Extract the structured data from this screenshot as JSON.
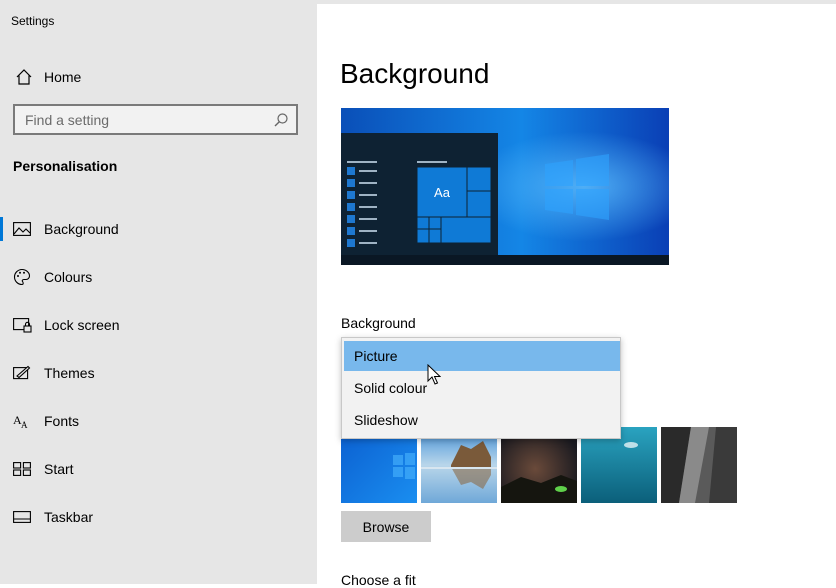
{
  "window": {
    "title": "Settings"
  },
  "sidebar": {
    "home_label": "Home",
    "search_placeholder": "Find a setting",
    "section_title": "Personalisation",
    "items": [
      {
        "label": "Background",
        "icon": "picture-icon",
        "active": true
      },
      {
        "label": "Colours",
        "icon": "palette-icon",
        "active": false
      },
      {
        "label": "Lock screen",
        "icon": "lock-screen-icon",
        "active": false
      },
      {
        "label": "Themes",
        "icon": "themes-icon",
        "active": false
      },
      {
        "label": "Fonts",
        "icon": "fonts-icon",
        "active": false
      },
      {
        "label": "Start",
        "icon": "start-icon",
        "active": false
      },
      {
        "label": "Taskbar",
        "icon": "taskbar-icon",
        "active": false
      }
    ]
  },
  "main": {
    "title": "Background",
    "preview_tile_text": "Aa",
    "background_label": "Background",
    "dropdown": {
      "options": [
        "Picture",
        "Solid colour",
        "Slideshow"
      ],
      "selected": "Picture"
    },
    "browse_label": "Browse",
    "fit_label": "Choose a fit"
  },
  "colors": {
    "accent": "#0078d7",
    "sidebar_bg": "#e6e6e6",
    "dropdown_highlight": "#78b8ec",
    "button_bg": "#cccccc"
  }
}
